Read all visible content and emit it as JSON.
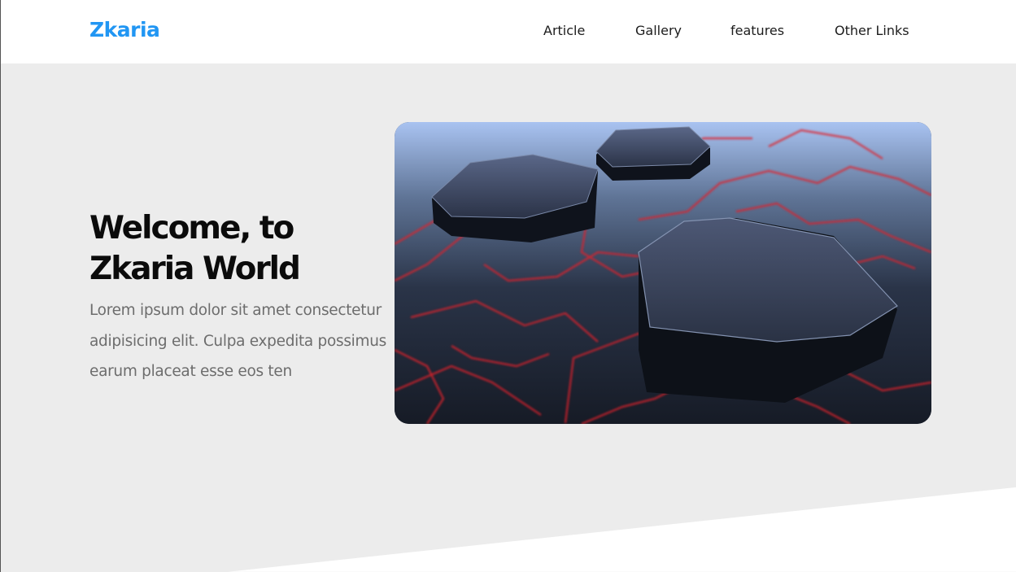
{
  "header": {
    "logo": "Zkaria",
    "nav": [
      {
        "label": "Article"
      },
      {
        "label": "Gallery"
      },
      {
        "label": "features"
      },
      {
        "label": "Other Links"
      }
    ]
  },
  "hero": {
    "title": "Welcome, to Zkaria World",
    "text": "Lorem ipsum dolor sit amet consectetur adipisicing elit. Culpa expedita possimus earum placeat esse eos ten"
  },
  "colors": {
    "brand": "#2196f3",
    "hero_background": "#ececec",
    "title": "#0b0b0b",
    "body_text": "#6d6d6d"
  }
}
